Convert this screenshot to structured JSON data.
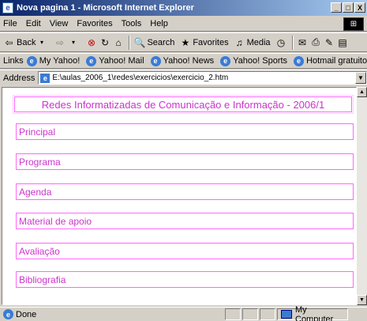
{
  "window": {
    "title": "Nova pagina 1 - Microsoft Internet Explorer",
    "buttons": [
      "_",
      "□",
      "X"
    ]
  },
  "menu": [
    "File",
    "Edit",
    "View",
    "Favorites",
    "Tools",
    "Help"
  ],
  "toolbar": {
    "back_label": "Back",
    "search_label": "Search",
    "favorites_label": "Favorites",
    "media_label": "Media"
  },
  "links": {
    "label": "Links",
    "items": [
      "My Yahoo!",
      "Yahoo! Mail",
      "Yahoo! News",
      "Yahoo! Sports",
      "Hotmail gratuito"
    ]
  },
  "address": {
    "label": "Address",
    "value": "E:\\aulas_2006_1\\redes\\exercicios\\exercicio_2.htm"
  },
  "page": {
    "header": "Redes Informatizadas de Comunicação e Informação - 2006/1",
    "nav": [
      "Principal",
      "Programa",
      "Agenda",
      "Material de apoio",
      "Avaliação",
      "Bibliografia"
    ],
    "accent_color": "#cc33cc"
  },
  "status": {
    "text": "Done",
    "zone": "My Computer"
  }
}
